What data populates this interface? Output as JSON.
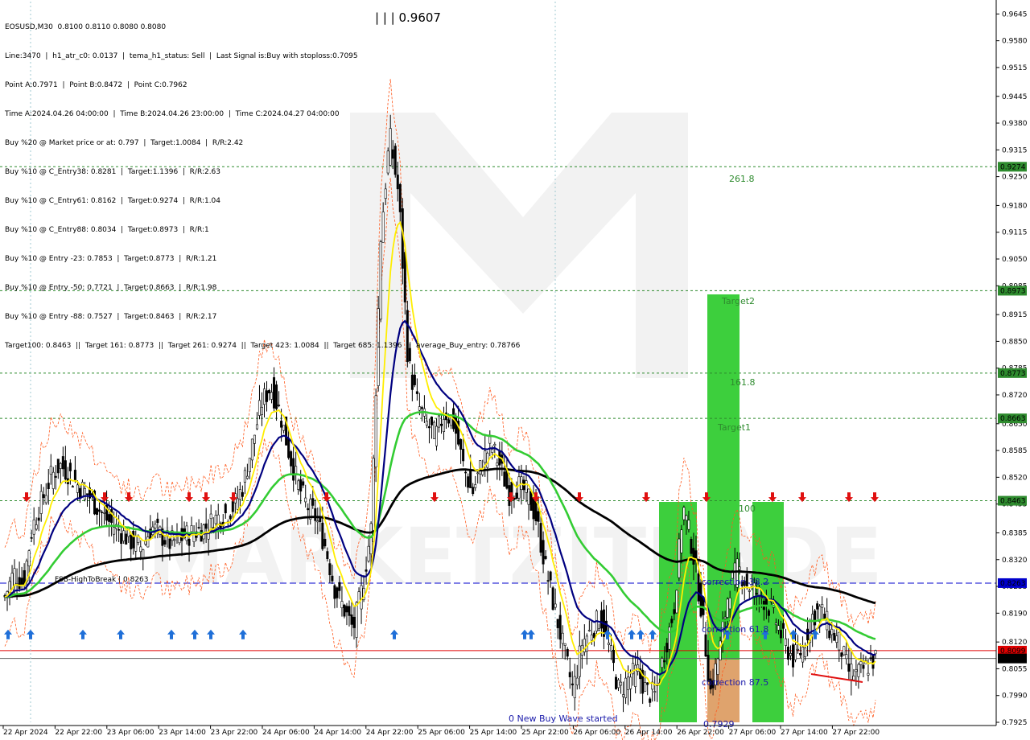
{
  "symbol_header": "EOSUSD,M30  0.8100 0.8110 0.8080 0.8080",
  "info_lines": [
    "Line:3470  |  h1_atr_c0: 0.0137  |  tema_h1_status: Sell  |  Last Signal is:Buy with stoploss:0.7095",
    "Point A:0.7971  |  Point B:0.8472  |  Point C:0.7962",
    "Time A:2024.04.26 04:00:00  |  Time B:2024.04.26 23:00:00  |  Time C:2024.04.27 04:00:00",
    "Buy %20 @ Market price or at: 0.797  |  Target:1.0084  |  R/R:2.42",
    "Buy %10 @ C_Entry38: 0.8281  |  Target:1.1396  |  R/R:2.63",
    "Buy %10 @ C_Entry61: 0.8162  |  Target:0.9274  |  R/R:1.04",
    "Buy %10 @ C_Entry88: 0.8034  |  Target:0.8973  |  R/R:1",
    "Buy %10 @ Entry -23: 0.7853  |  Target:0.8773  |  R/R:1.21",
    "Buy %10 @ Entry -50: 0.7721  |  Target:0.8663  |  R/R:1.98",
    "Buy %10 @ Entry -88: 0.7527  |  Target:0.8463  |  R/R:2.17",
    "Target100: 0.8463  ||  Target 161: 0.8773  ||  Target 261: 0.9274  ||  Target 423: 1.0084  ||  Target 685: 1.1396  ||  average_Buy_entry: 0.78766"
  ],
  "peak_label": "| | | 0.9607",
  "chart_data": {
    "type": "candlestick",
    "symbol": "EOSUSD",
    "timeframe": "M30",
    "ylim": [
      0.7925,
      0.9675
    ],
    "y_ticks": [
      "0.9645",
      "0.9580",
      "0.9515",
      "0.9445",
      "0.9380",
      "0.9315",
      "0.9250",
      "0.9180",
      "0.9115",
      "0.9050",
      "0.8985",
      "0.8915",
      "0.8850",
      "0.8785",
      "0.8720",
      "0.8650",
      "0.8585",
      "0.8520",
      "0.8455",
      "0.8385",
      "0.8320",
      "0.8255",
      "0.8190",
      "0.8120",
      "0.8055",
      "0.7990",
      "0.7925"
    ],
    "x_ticks": [
      "22 Apr 2024",
      "22 Apr 22:00",
      "23 Apr 06:00",
      "23 Apr 14:00",
      "23 Apr 22:00",
      "24 Apr 06:00",
      "24 Apr 14:00",
      "24 Apr 22:00",
      "25 Apr 06:00",
      "25 Apr 14:00",
      "25 Apr 22:00",
      "26 Apr 06:00",
      "26 Apr 14:00",
      "26 Apr 22:00",
      "27 Apr 06:00",
      "27 Apr 14:00",
      "27 Apr 22:00"
    ],
    "levels": [
      {
        "value": 0.9274,
        "label": "261.8",
        "color": "#2e8b2e",
        "style": "dotted"
      },
      {
        "value": 0.8973,
        "label": "Target2",
        "color": "#2e8b2e",
        "style": "dotted"
      },
      {
        "value": 0.8773,
        "label": "161.8",
        "color": "#2e8b2e",
        "style": "dotted"
      },
      {
        "value": 0.8663,
        "label": "Target1",
        "color": "#2e8b2e",
        "style": "dotted"
      },
      {
        "value": 0.8463,
        "label": "100",
        "color": "#2e8b2e",
        "style": "dotted"
      },
      {
        "value": 0.8263,
        "label": "FSB-HighToBreak  |  0.8263",
        "color": "#0000cc",
        "style": "dashed"
      },
      {
        "value": 0.8099,
        "label": "",
        "color": "#e00000",
        "style": "solid"
      },
      {
        "value": 0.808,
        "label": "",
        "color": "#666666",
        "style": "solid"
      }
    ],
    "price_tags": [
      {
        "value": 0.9274,
        "text": "0.9274",
        "color": "#2e8b2e"
      },
      {
        "value": 0.8973,
        "text": "0.8973",
        "color": "#2e8b2e"
      },
      {
        "value": 0.8773,
        "text": "0.8773",
        "color": "#2e8b2e"
      },
      {
        "value": 0.8663,
        "text": "0.8663",
        "color": "#2e8b2e"
      },
      {
        "value": 0.8463,
        "text": "0.8463",
        "color": "#2e8b2e"
      },
      {
        "value": 0.8263,
        "text": "0.8263",
        "color": "#0000cc"
      },
      {
        "value": 0.8099,
        "text": "0.8099",
        "color": "#e00000"
      },
      {
        "value": 0.808,
        "text": "0.8080",
        "color": "#000000"
      }
    ],
    "annotations": [
      "correction 38.2",
      "correction 61.8",
      "correction 87.5",
      "0 New Buy Wave started",
      "0.7929"
    ],
    "close_series": [
      0.823,
      0.829,
      0.826,
      0.84,
      0.846,
      0.852,
      0.855,
      0.853,
      0.85,
      0.848,
      0.845,
      0.842,
      0.84,
      0.838,
      0.836,
      0.835,
      0.84,
      0.838,
      0.836,
      0.837,
      0.838,
      0.839,
      0.84,
      0.842,
      0.843,
      0.845,
      0.85,
      0.86,
      0.87,
      0.874,
      0.868,
      0.858,
      0.85,
      0.845,
      0.842,
      0.835,
      0.825,
      0.82,
      0.815,
      0.825,
      0.84,
      0.91,
      0.935,
      0.92,
      0.88,
      0.87,
      0.865,
      0.862,
      0.868,
      0.865,
      0.855,
      0.848,
      0.855,
      0.86,
      0.855,
      0.848,
      0.85,
      0.848,
      0.842,
      0.83,
      0.82,
      0.81,
      0.8,
      0.812,
      0.815,
      0.818,
      0.81,
      0.8,
      0.803,
      0.805,
      0.8,
      0.799,
      0.81,
      0.82,
      0.845,
      0.835,
      0.82,
      0.8,
      0.81,
      0.825,
      0.83,
      0.826,
      0.824,
      0.822,
      0.818,
      0.812,
      0.808,
      0.81,
      0.818,
      0.82,
      0.815,
      0.812,
      0.805,
      0.804,
      0.806,
      0.808
    ],
    "moving_averages": [
      {
        "name": "MA slow",
        "color": "#000000"
      },
      {
        "name": "MA mid",
        "color": "#33cc33"
      },
      {
        "name": "MA fast",
        "color": "#000080"
      },
      {
        "name": "MA fastest",
        "color": "#ffee00"
      }
    ],
    "grid": false
  }
}
